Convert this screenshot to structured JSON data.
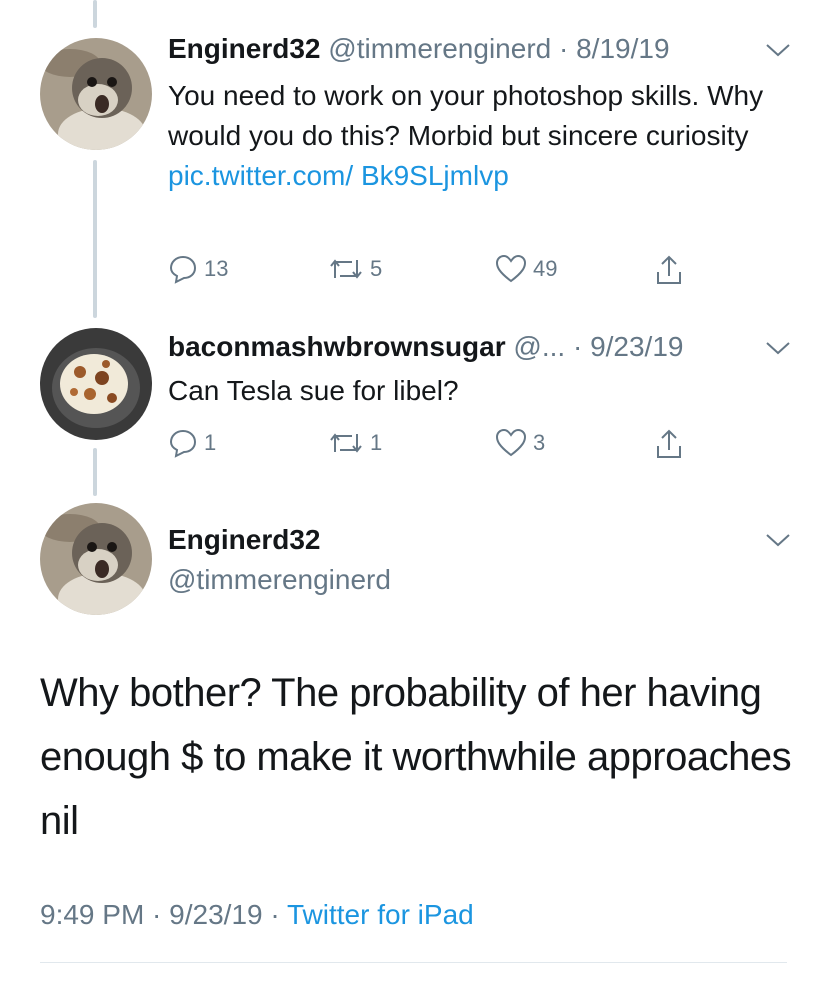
{
  "tweets": [
    {
      "name": "Enginerd32",
      "handle": "@timmerenginerd",
      "sep": " · ",
      "date": "8/19/19",
      "text": "You need to work on your photoshop skills. Why would you do this? Morbid but sincere curiosity ",
      "link": "pic.twitter.com/ Bk9SLjmlvp",
      "replies": "13",
      "retweets": "5",
      "likes": "49",
      "avatar_icon": "seal-avatar"
    },
    {
      "name": "baconmashwbrownsugar",
      "handle": "@...",
      "sep": " · ",
      "date": "9/23/19",
      "text": "Can Tesla sue for libel?",
      "replies": "1",
      "retweets": "1",
      "likes": "3",
      "avatar_icon": "food-avatar"
    }
  ],
  "main_tweet": {
    "name": "Enginerd32",
    "handle": "@timmerenginerd",
    "text": "Why bother? The probability of her having enough $ to make it worthwhile approaches nil",
    "time": "9:49 PM",
    "sep1": " · ",
    "date": "9/23/19",
    "sep2": " · ",
    "source": "Twitter for iPad"
  },
  "colors": {
    "link": "#1b95e0",
    "meta": "#657786",
    "thread_line": "#ccd6dd"
  }
}
